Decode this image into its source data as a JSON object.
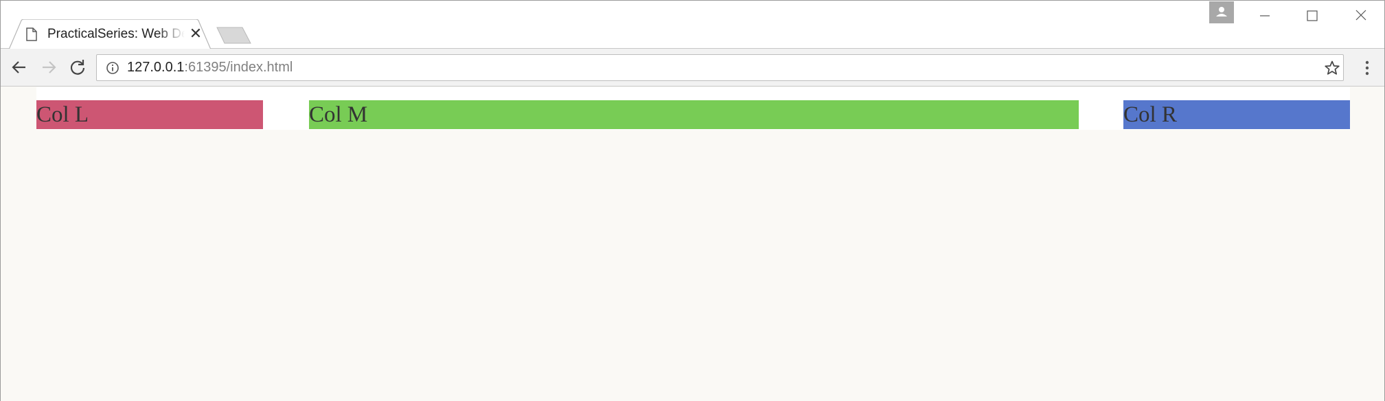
{
  "browser": {
    "tab": {
      "title": "PracticalSeries: Web Development",
      "icon": "document-icon"
    },
    "url": {
      "host": "127.0.0.1",
      "rest": ":61395/index.html"
    }
  },
  "page": {
    "columns": [
      {
        "label": "Col L",
        "color": "#cd5673"
      },
      {
        "label": "Col M",
        "color": "#78cc55"
      },
      {
        "label": "Col R",
        "color": "#5677cc"
      }
    ]
  }
}
